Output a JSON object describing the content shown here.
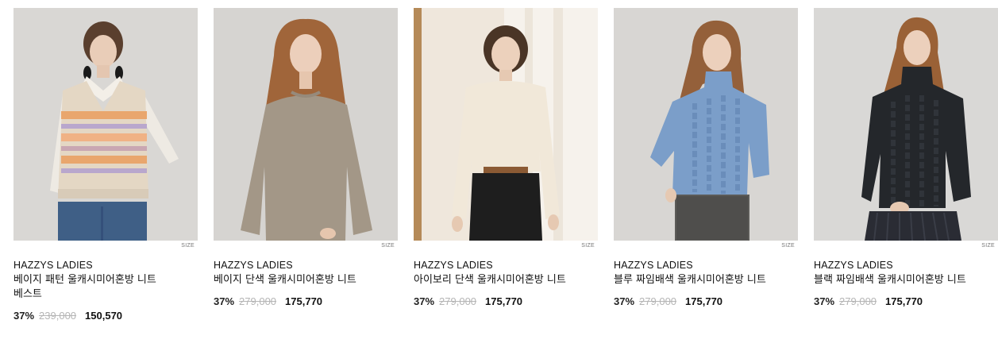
{
  "products": [
    {
      "brand": "HAZZYS LADIES",
      "name": "베이지 패턴 울캐시미어혼방 니트 베스트",
      "discount": "37%",
      "original_price": "239,000",
      "sale_price": "150,570",
      "size_label": "SIZE"
    },
    {
      "brand": "HAZZYS LADIES",
      "name": "베이지 단색 울캐시미어혼방 니트",
      "discount": "37%",
      "original_price": "279,000",
      "sale_price": "175,770",
      "size_label": "SIZE"
    },
    {
      "brand": "HAZZYS LADIES",
      "name": "아이보리 단색 울캐시미어혼방 니트",
      "discount": "37%",
      "original_price": "279,000",
      "sale_price": "175,770",
      "size_label": "SIZE"
    },
    {
      "brand": "HAZZYS LADIES",
      "name": "블루 짜임배색 울캐시미어혼방 니트",
      "discount": "37%",
      "original_price": "279,000",
      "sale_price": "175,770",
      "size_label": "SIZE"
    },
    {
      "brand": "HAZZYS LADIES",
      "name": "블랙 짜임배색 울캐시미어혼방 니트",
      "discount": "37%",
      "original_price": "279,000",
      "sale_price": "175,770",
      "size_label": "SIZE"
    }
  ],
  "colors": {
    "discount": "#222222",
    "original_price": "#b5b5b5",
    "sale_price": "#111111"
  }
}
